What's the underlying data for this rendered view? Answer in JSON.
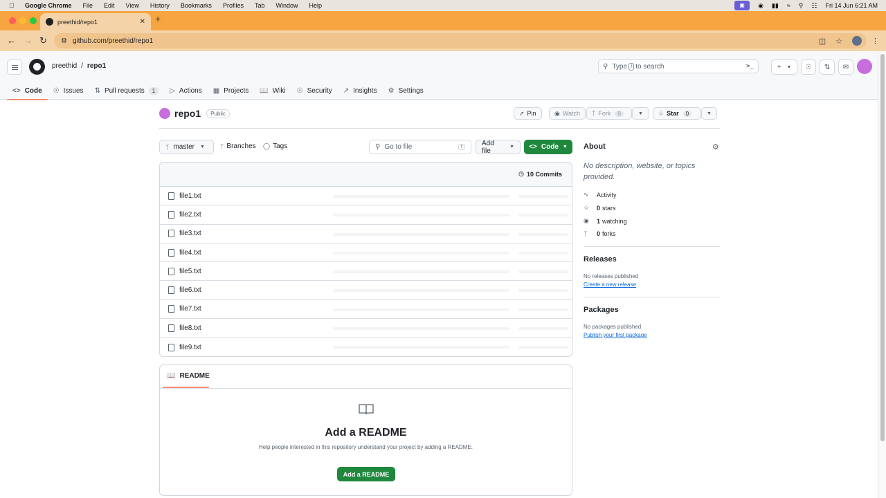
{
  "menubar": {
    "app_name": "Google Chrome",
    "items": [
      "File",
      "Edit",
      "View",
      "History",
      "Bookmarks",
      "Profiles",
      "Tab",
      "Window",
      "Help"
    ],
    "datetime": "Fri 14 Jun  6:21 AM"
  },
  "browser": {
    "tab_title": "preethid/repo1",
    "url": "github.com/preethid/repo1",
    "tab_bar_color": "#f7a541"
  },
  "header": {
    "owner": "preethid",
    "separator": "/",
    "repo": "repo1",
    "search_placeholder_pre": "Type",
    "search_key": "/",
    "search_placeholder_post": "to search",
    "plus": "+"
  },
  "repo_nav": [
    {
      "label": "Code",
      "icon": "code-icon"
    },
    {
      "label": "Issues",
      "icon": "issue-icon"
    },
    {
      "label": "Pull requests",
      "icon": "pull-request-icon",
      "count": "1"
    },
    {
      "label": "Actions",
      "icon": "play-icon"
    },
    {
      "label": "Projects",
      "icon": "table-icon"
    },
    {
      "label": "Wiki",
      "icon": "book-icon"
    },
    {
      "label": "Security",
      "icon": "shield-icon"
    },
    {
      "label": "Insights",
      "icon": "graph-icon"
    },
    {
      "label": "Settings",
      "icon": "gear-icon"
    }
  ],
  "repo": {
    "name": "repo1",
    "visibility": "Public",
    "pin": "Pin",
    "watch": "Watch",
    "fork": "Fork",
    "fork_count": "0",
    "star": "Star",
    "star_count": "0"
  },
  "files_toolbar": {
    "branch": "master",
    "branches": "Branches",
    "tags": "Tags",
    "goto_placeholder": "Go to file",
    "goto_key": "t",
    "add_file": "Add file",
    "code": "Code"
  },
  "commits": "10 Commits",
  "files": [
    "file1.txt",
    "file2.txt",
    "file3.txt",
    "file4.txt",
    "file5.txt",
    "file6.txt",
    "file7.txt",
    "file8.txt",
    "file9.txt"
  ],
  "readme": {
    "tab": "README",
    "title": "Add a README",
    "description": "Help people interested in this repository understand your project by adding a README.",
    "button": "Add a README"
  },
  "sidebar": {
    "about_title": "About",
    "about_desc": "No description, website, or topics provided.",
    "activity": "Activity",
    "stars_count": "0",
    "stars_label": "stars",
    "watching_count": "1",
    "watching_label": "watching",
    "forks_count": "0",
    "forks_label": "forks",
    "releases_title": "Releases",
    "releases_none": "No releases published",
    "releases_link": "Create a new release",
    "packages_title": "Packages",
    "packages_none": "No packages published",
    "packages_link": "Publish your first package"
  },
  "colors": {
    "primary_button": "#1f883d",
    "active_underline": "#fd8c73",
    "link": "#0969da"
  }
}
